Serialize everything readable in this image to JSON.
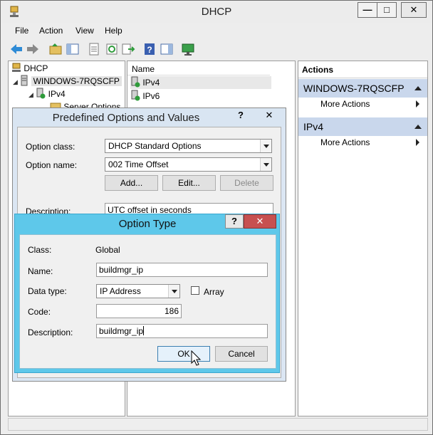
{
  "window": {
    "title": "DHCP"
  },
  "titlebar_buttons": {
    "minimize": "—",
    "maximize": "□",
    "close": "✕"
  },
  "menu": [
    "File",
    "Action",
    "View",
    "Help"
  ],
  "toolbar_icons": [
    "back-icon",
    "forward-icon",
    "up-folder-icon",
    "show-tree-icon",
    "properties-icon",
    "refresh-icon",
    "export-icon",
    "help-icon",
    "show-action-pane-icon",
    "monitor-icon"
  ],
  "tree": {
    "root": "DHCP",
    "server": "WINDOWS-7RQSCFP",
    "ipv4": "IPv4",
    "server_options": "Server Options"
  },
  "list": {
    "column": "Name",
    "rows": [
      "IPv4",
      "IPv6"
    ]
  },
  "actions": {
    "header": "Actions",
    "groups": [
      {
        "title": "WINDOWS-7RQSCFP",
        "item": "More Actions"
      },
      {
        "title": "IPv4",
        "item": "More Actions"
      }
    ]
  },
  "dialog1": {
    "title": "Predefined Options and Values",
    "help": "?",
    "close": "✕",
    "option_class_label": "Option class:",
    "option_class_value": "DHCP Standard Options",
    "option_name_label": "Option name:",
    "option_name_value": "002 Time Offset",
    "add": "Add...",
    "edit": "Edit...",
    "delete": "Delete",
    "description_label": "Description:",
    "description_value": "UTC offset in seconds"
  },
  "dialog2": {
    "title": "Option Type",
    "help": "?",
    "close": "✕",
    "class_label": "Class:",
    "class_value": "Global",
    "name_label": "Name:",
    "name_value": "buildmgr_ip",
    "datatype_label": "Data type:",
    "datatype_value": "IP Address",
    "array_label": "Array",
    "code_label": "Code:",
    "code_value": "186",
    "description_label": "Description:",
    "description_value": "buildmgr_ip",
    "ok": "OK",
    "cancel": "Cancel"
  },
  "colors": {
    "accent_blue": "#5ec8ea",
    "close_red": "#c75050",
    "action_group": "#c9d7ec"
  }
}
